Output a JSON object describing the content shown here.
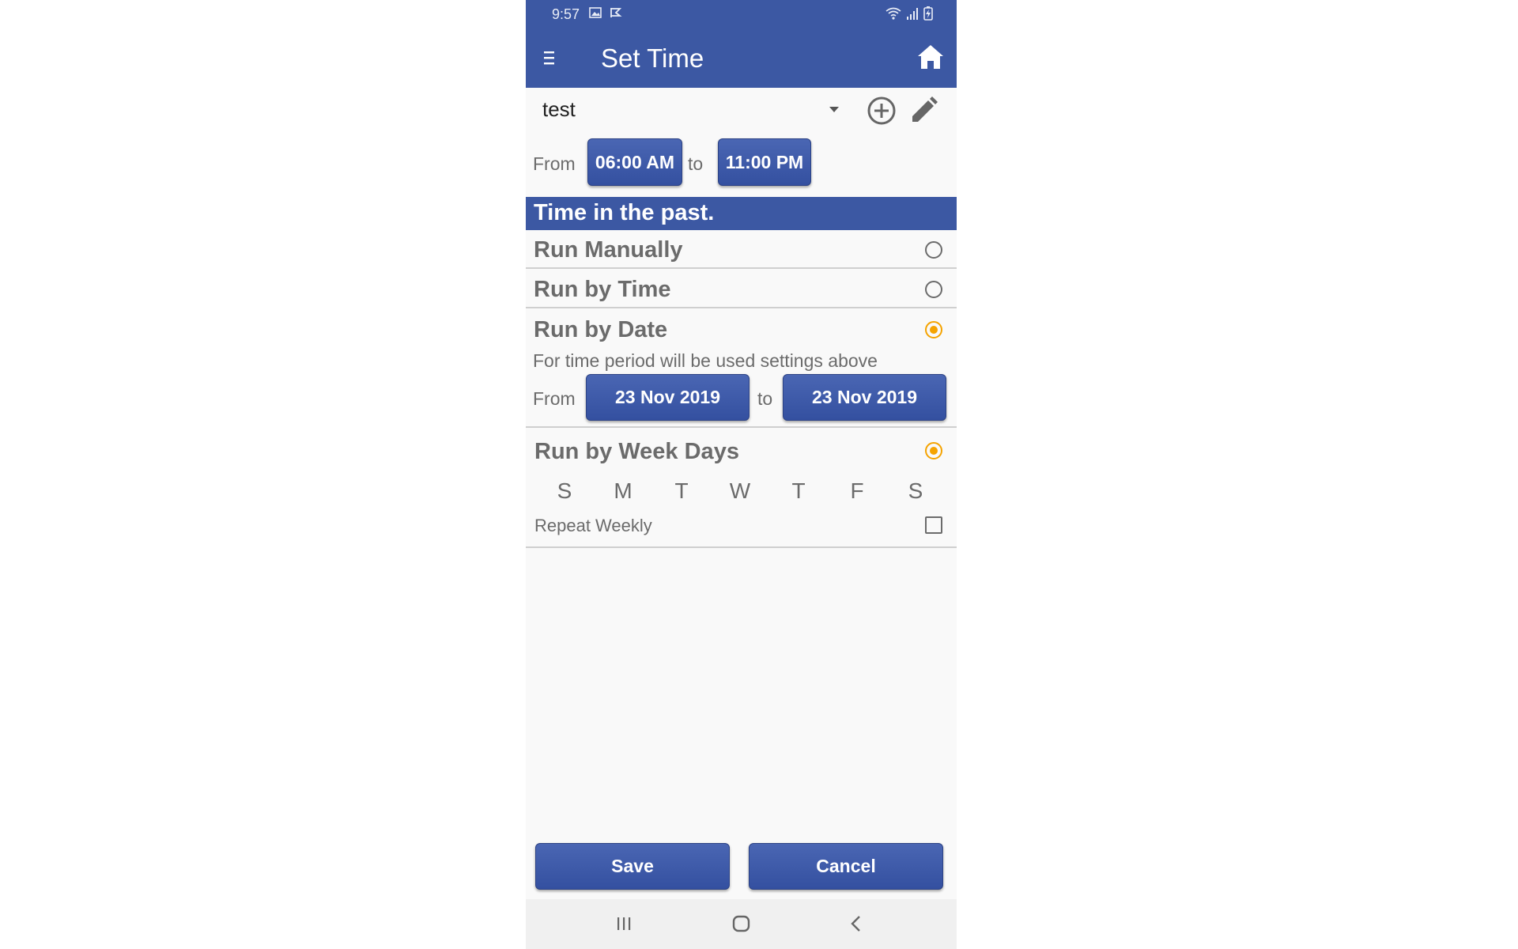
{
  "status_bar": {
    "time": "9:57"
  },
  "app_bar": {
    "title": "Set Time"
  },
  "profile": {
    "name": "test"
  },
  "time_range": {
    "from_label": "From",
    "from_value": "06:00 AM",
    "to_label": "to",
    "to_value": "11:00 PM"
  },
  "section_header": "Time in the past.",
  "options": {
    "run_manually": {
      "label": "Run Manually",
      "selected": false
    },
    "run_by_time": {
      "label": "Run by Time",
      "selected": false
    },
    "run_by_date": {
      "label": "Run by Date",
      "selected": true,
      "note": "For time period will be used settings above",
      "from_label": "From",
      "from_value": "23 Nov 2019",
      "to_label": "to",
      "to_value": "23 Nov 2019"
    },
    "run_by_week_days": {
      "label": "Run by Week Days",
      "selected": true,
      "days": [
        "S",
        "M",
        "T",
        "W",
        "T",
        "F",
        "S"
      ],
      "repeat_label": "Repeat Weekly",
      "repeat_checked": false
    }
  },
  "actions": {
    "save_label": "Save",
    "cancel_label": "Cancel"
  },
  "colors": {
    "primary": "#3c58a3",
    "radio_selected": "#f5a300",
    "background": "#f9f9f9"
  }
}
